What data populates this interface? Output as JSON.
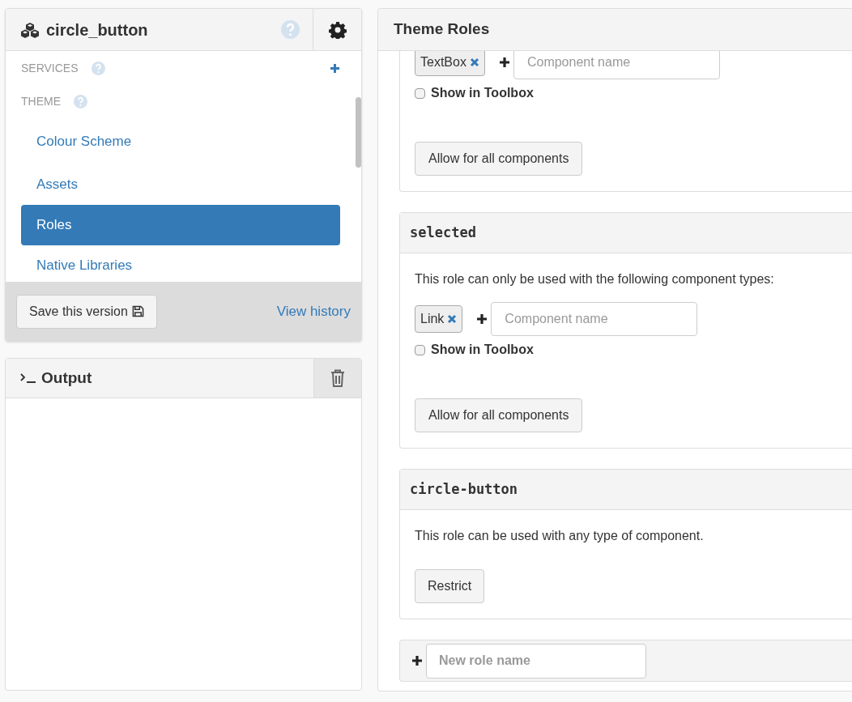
{
  "app": {
    "title": "circle_button"
  },
  "sidebar": {
    "sections": [
      {
        "label": "SERVICES",
        "kind": "add"
      },
      {
        "label": "THEME",
        "kind": "plain"
      }
    ],
    "items": [
      {
        "label": "Colour Scheme",
        "selected": false
      },
      {
        "label": "Assets",
        "selected": false
      },
      {
        "label": "Roles",
        "selected": true
      },
      {
        "label": "Native Libraries",
        "selected": false
      }
    ],
    "save_button": "Save this version",
    "history_link": "View history"
  },
  "output": {
    "title": "Output"
  },
  "roles_panel": {
    "title": "Theme Roles",
    "roles": [
      {
        "kind": "restricted",
        "components": [
          "TextBox"
        ],
        "placeholder": "Component name",
        "show_in_toolbox": {
          "label": "Show in Toolbox",
          "checked": false
        },
        "button": "Allow for all components"
      },
      {
        "kind": "restricted",
        "name": "selected",
        "description": "This role can only be used with the following component types:",
        "components": [
          "Link"
        ],
        "placeholder": "Component name",
        "show_in_toolbox": {
          "label": "Show in Toolbox",
          "checked": false
        },
        "button": "Allow for all components"
      },
      {
        "kind": "any",
        "name": "circle-button",
        "description": "This role can be used with any type of component.",
        "button": "Restrict"
      }
    ],
    "new_role": {
      "placeholder": "New role name"
    }
  }
}
